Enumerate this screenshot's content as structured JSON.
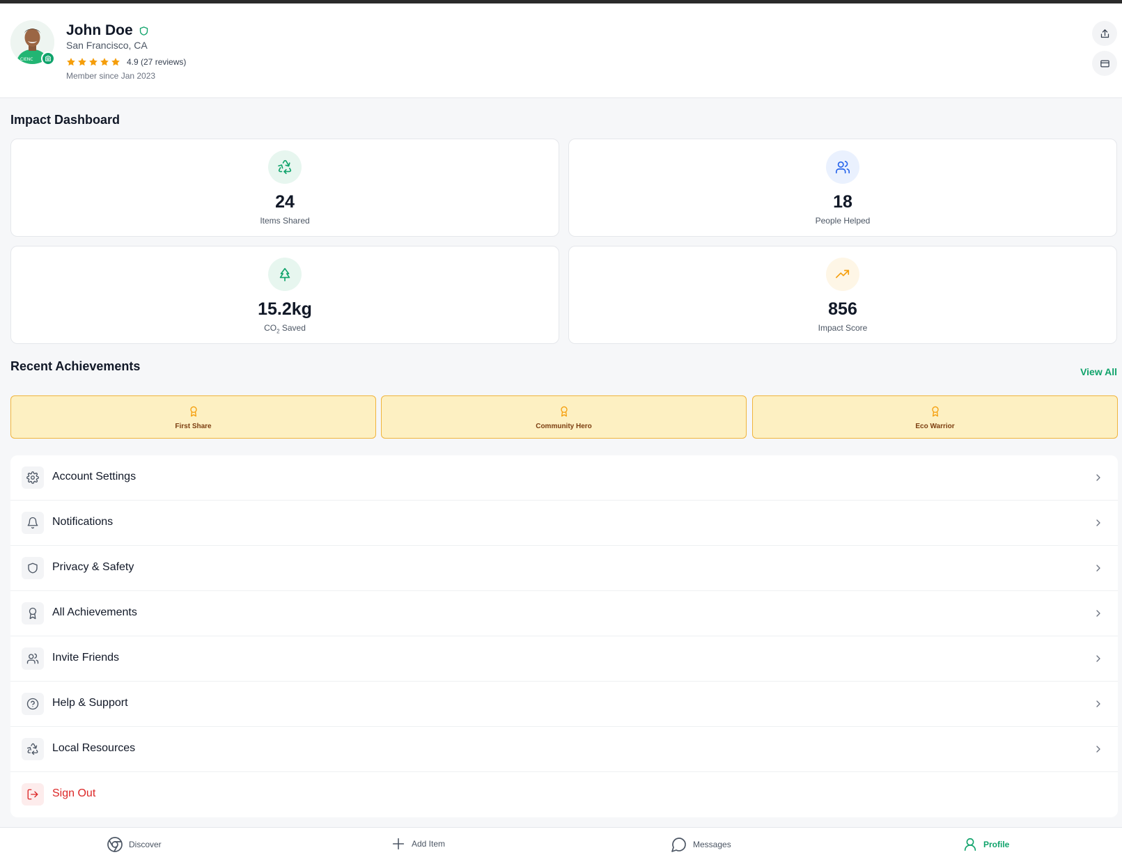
{
  "profile": {
    "name": "John Doe",
    "location": "San Francisco, CA",
    "rating": 4.9,
    "rating_text": "4.9 (27 reviews)",
    "member_since": "Member since Jan 2023"
  },
  "dashboard": {
    "title": "Impact Dashboard",
    "stats": [
      {
        "value": "24",
        "label": "Items Shared",
        "icon": "recycle-icon",
        "color": "#10a36b",
        "bg": "#e7f6ef"
      },
      {
        "value": "18",
        "label": "People Helped",
        "icon": "users-icon",
        "color": "#2563eb",
        "bg": "#eaf1fe"
      },
      {
        "value": "15.2kg",
        "label_main": "CO",
        "label_sub": "2",
        "label_rest": " Saved",
        "icon": "tree-icon",
        "color": "#10a36b",
        "bg": "#e7f6ef"
      },
      {
        "value": "856",
        "label": "Impact Score",
        "icon": "trending-up-icon",
        "color": "#f59e0b",
        "bg": "#fef6e6"
      }
    ]
  },
  "achievements": {
    "title": "Recent Achievements",
    "view_all": "View All",
    "items": [
      {
        "label": "First Share"
      },
      {
        "label": "Community Hero"
      },
      {
        "label": "Eco Warrior"
      }
    ]
  },
  "menu": {
    "items": [
      {
        "label": "Account Settings",
        "icon": "gear-icon"
      },
      {
        "label": "Notifications",
        "icon": "bell-icon"
      },
      {
        "label": "Privacy & Safety",
        "icon": "shield-icon"
      },
      {
        "label": "All Achievements",
        "icon": "award-icon"
      },
      {
        "label": "Invite Friends",
        "icon": "users-icon"
      },
      {
        "label": "Help & Support",
        "icon": "help-circle-icon"
      },
      {
        "label": "Local Resources",
        "icon": "recycle-icon"
      },
      {
        "label": "Sign Out",
        "icon": "log-out-icon"
      }
    ]
  },
  "nav": {
    "items": [
      {
        "label": "Discover",
        "icon": "chrome-icon"
      },
      {
        "label": "Add Item",
        "icon": "plus-icon"
      },
      {
        "label": "Messages",
        "icon": "message-circle-icon"
      },
      {
        "label": "Profile",
        "icon": "user-icon",
        "active": true
      }
    ]
  },
  "colors": {
    "brand": "#10a36b",
    "star": "#f59e0b",
    "danger": "#dc2626",
    "achievement_bg": "#fdf0c2",
    "achievement_border": "#f0b43c"
  }
}
